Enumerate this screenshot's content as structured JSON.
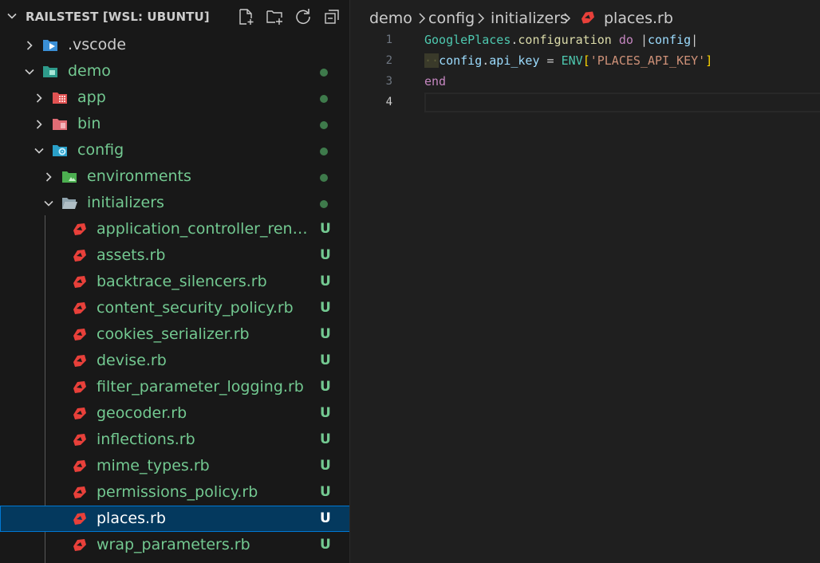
{
  "explorer": {
    "title": "RAILSTEST [WSL: UBUNTU]",
    "actions": [
      "new-file-icon",
      "new-folder-icon",
      "refresh-icon",
      "collapse-all-icon"
    ],
    "items": [
      {
        "label": ".vscode",
        "icon": "vscode-folder-icon",
        "state": "collapsed",
        "status": ""
      },
      {
        "label": "demo",
        "icon": "folder-icon",
        "state": "expanded",
        "status": "modified-dot"
      },
      {
        "label": "app",
        "icon": "app-folder-icon",
        "state": "collapsed",
        "status": "modified-dot"
      },
      {
        "label": "bin",
        "icon": "bin-folder-icon",
        "state": "collapsed",
        "status": "modified-dot"
      },
      {
        "label": "config",
        "icon": "config-folder-icon",
        "state": "expanded",
        "status": "modified-dot"
      },
      {
        "label": "environments",
        "icon": "environments-folder-icon",
        "state": "collapsed",
        "status": "modified-dot"
      },
      {
        "label": "initializers",
        "icon": "open-folder-icon",
        "state": "expanded",
        "status": "modified-dot"
      },
      {
        "label": "application_controller_render...",
        "icon": "ruby-icon",
        "status": "U"
      },
      {
        "label": "assets.rb",
        "icon": "ruby-icon",
        "status": "U"
      },
      {
        "label": "backtrace_silencers.rb",
        "icon": "ruby-icon",
        "status": "U"
      },
      {
        "label": "content_security_policy.rb",
        "icon": "ruby-icon",
        "status": "U"
      },
      {
        "label": "cookies_serializer.rb",
        "icon": "ruby-icon",
        "status": "U"
      },
      {
        "label": "devise.rb",
        "icon": "ruby-icon",
        "status": "U"
      },
      {
        "label": "filter_parameter_logging.rb",
        "icon": "ruby-icon",
        "status": "U"
      },
      {
        "label": "geocoder.rb",
        "icon": "ruby-icon",
        "status": "U"
      },
      {
        "label": "inflections.rb",
        "icon": "ruby-icon",
        "status": "U"
      },
      {
        "label": "mime_types.rb",
        "icon": "ruby-icon",
        "status": "U"
      },
      {
        "label": "permissions_policy.rb",
        "icon": "ruby-icon",
        "status": "U"
      },
      {
        "label": "places.rb",
        "icon": "ruby-icon",
        "status": "U",
        "selected": true
      },
      {
        "label": "wrap_parameters.rb",
        "icon": "ruby-icon",
        "status": "U"
      }
    ]
  },
  "breadcrumbs": [
    "demo",
    "config",
    "initializers",
    "places.rb"
  ],
  "editor": {
    "line_numbers": [
      "1",
      "2",
      "3",
      "4"
    ],
    "active_line": "4",
    "lines": {
      "l1": {
        "const": "GooglePlaces",
        "dot": ".",
        "meth": "configuration",
        "sp1": " ",
        "kw": "do",
        "sp2": " ",
        "pipe1": "|",
        "var": "config",
        "pipe2": "|"
      },
      "l2": {
        "indent": "··",
        "var": "config",
        "dot": ".",
        "meth": "api_key",
        "op": " = ",
        "const": "ENV",
        "lbr": "[",
        "str": "'PLACES_API_KEY'",
        "rbr": "]"
      },
      "l3": {
        "kw": "end"
      },
      "l4": {
        "text": ""
      }
    }
  },
  "colors": {
    "git_untracked": "#73c991",
    "selection_bg": "#04395e",
    "selection_border": "#0078d4",
    "ruby_red": "#e8403a"
  }
}
